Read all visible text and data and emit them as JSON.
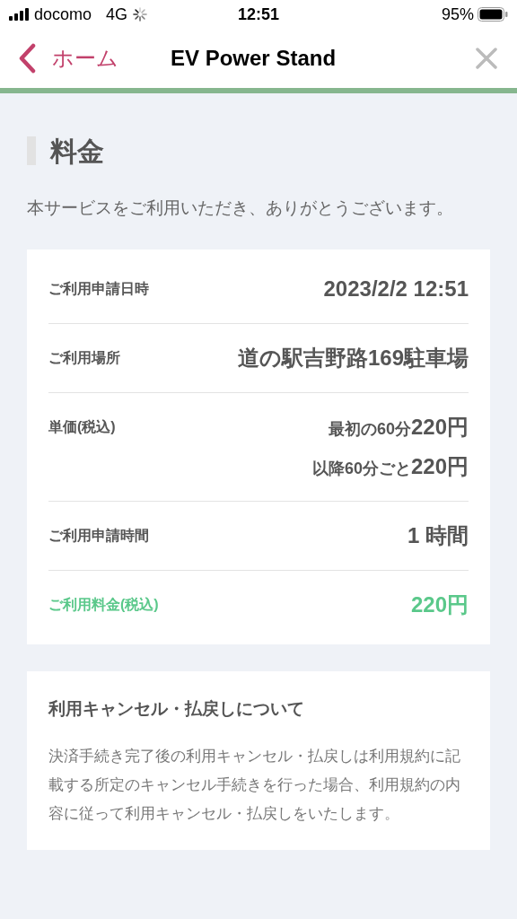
{
  "status_bar": {
    "carrier": "docomo",
    "network": "4G",
    "time": "12:51",
    "battery": "95%"
  },
  "nav": {
    "back_label": "ホーム",
    "title": "EV Power Stand"
  },
  "section": {
    "heading": "料金",
    "intro": "本サービスをご利用いただき、ありがとうございます。"
  },
  "details": [
    {
      "label": "ご利用申請日時",
      "highlight": false,
      "lines": [
        {
          "amount": "2023/2/2 12:51"
        }
      ]
    },
    {
      "label": "ご利用場所",
      "highlight": false,
      "lines": [
        {
          "amount": "道の駅吉野路169駐車場"
        }
      ]
    },
    {
      "label": "単価(税込)",
      "highlight": false,
      "lines": [
        {
          "prefix": "最初の60分",
          "amount": "220円"
        },
        {
          "prefix": "以降60分ごと",
          "amount": "220円"
        }
      ]
    },
    {
      "label": "ご利用申請時間",
      "highlight": false,
      "lines": [
        {
          "amount": "1 時間"
        }
      ]
    },
    {
      "label": "ご利用料金(税込)",
      "highlight": true,
      "lines": [
        {
          "amount": "220円"
        }
      ]
    }
  ],
  "notice": {
    "title": "利用キャンセル・払戻しについて",
    "body": "決済手続き完了後の利用キャンセル・払戻しは利用規約に記載する所定のキャンセル手続きを行った場合、利用規約の内容に従って利用キャンセル・払戻しをいたします。"
  }
}
